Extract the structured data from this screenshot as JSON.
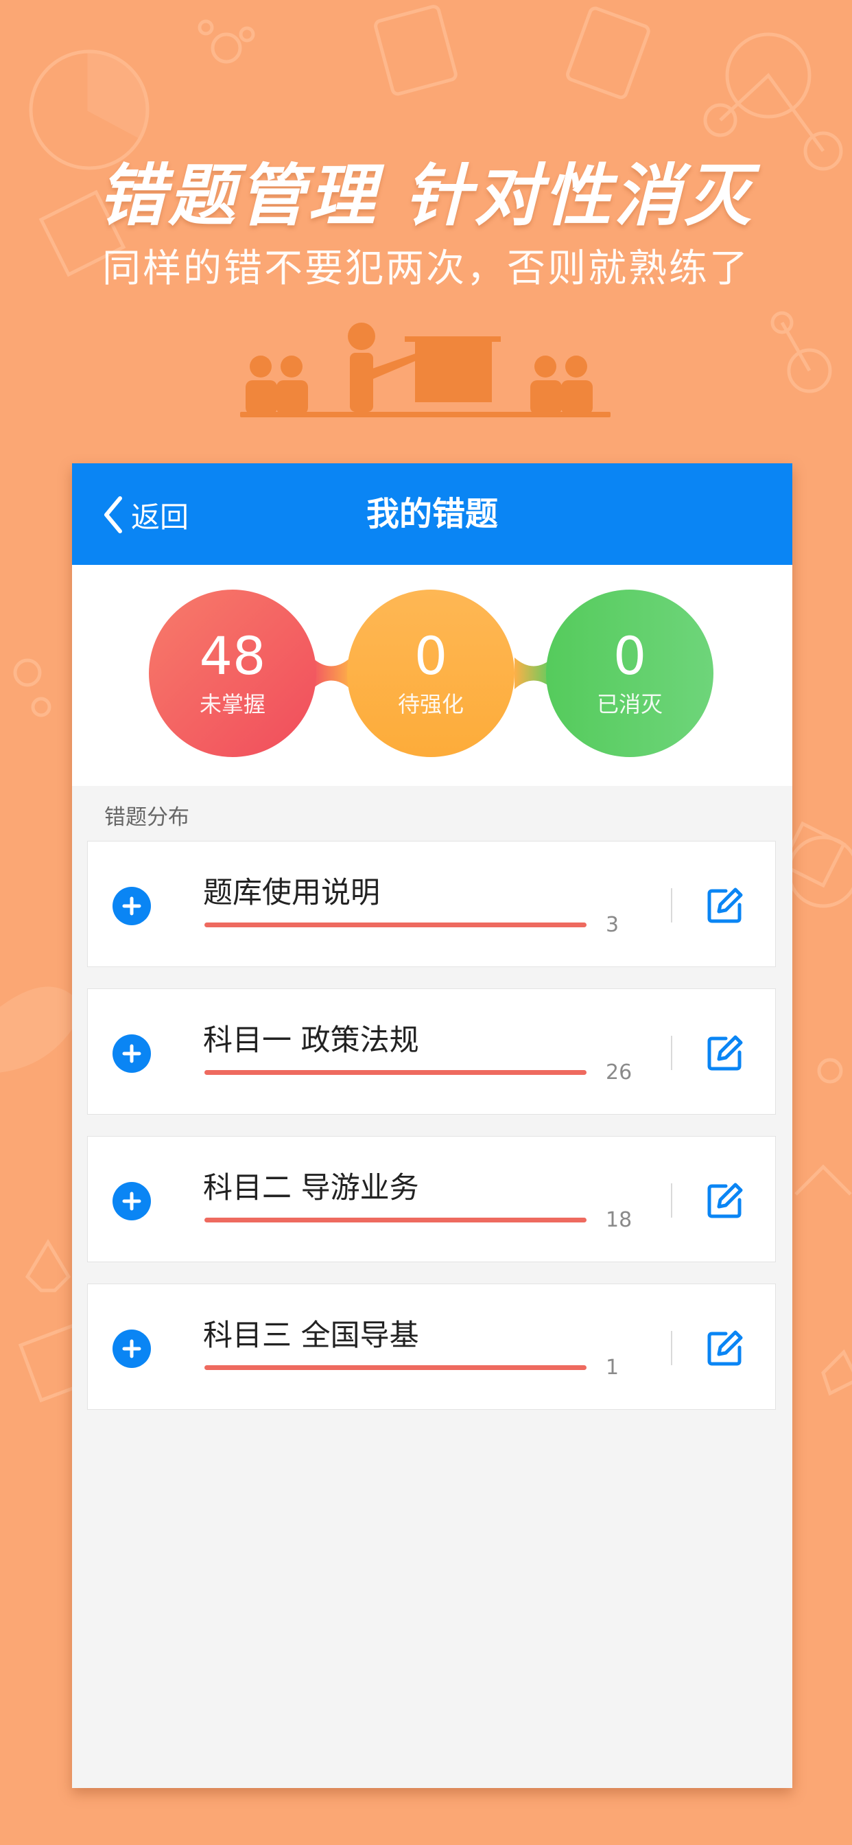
{
  "promo": {
    "title": "错题管理 针对性消灭",
    "subtitle": "同样的错不要犯两次，否则就熟练了"
  },
  "navbar": {
    "back_label": "返回",
    "title": "我的错题"
  },
  "stats": [
    {
      "value": "48",
      "label": "未掌握",
      "color": "#F36066"
    },
    {
      "value": "0",
      "label": "待强化",
      "color": "#FDB247"
    },
    {
      "value": "0",
      "label": "已消灭",
      "color": "#5FCF64"
    }
  ],
  "section": {
    "label": "错题分布"
  },
  "categories": [
    {
      "name": "题库使用说明",
      "count": "3"
    },
    {
      "name": "科目一 政策法规",
      "count": "26"
    },
    {
      "name": "科目二 导游业务",
      "count": "18"
    },
    {
      "name": "科目三 全国导基",
      "count": "1"
    }
  ],
  "colors": {
    "background": "#FBA774",
    "accent_blue": "#0A85F4",
    "progress_red": "#EE6A5F"
  },
  "icons": [
    "chevron-left-icon",
    "plus-circle-icon",
    "edit-icon"
  ]
}
